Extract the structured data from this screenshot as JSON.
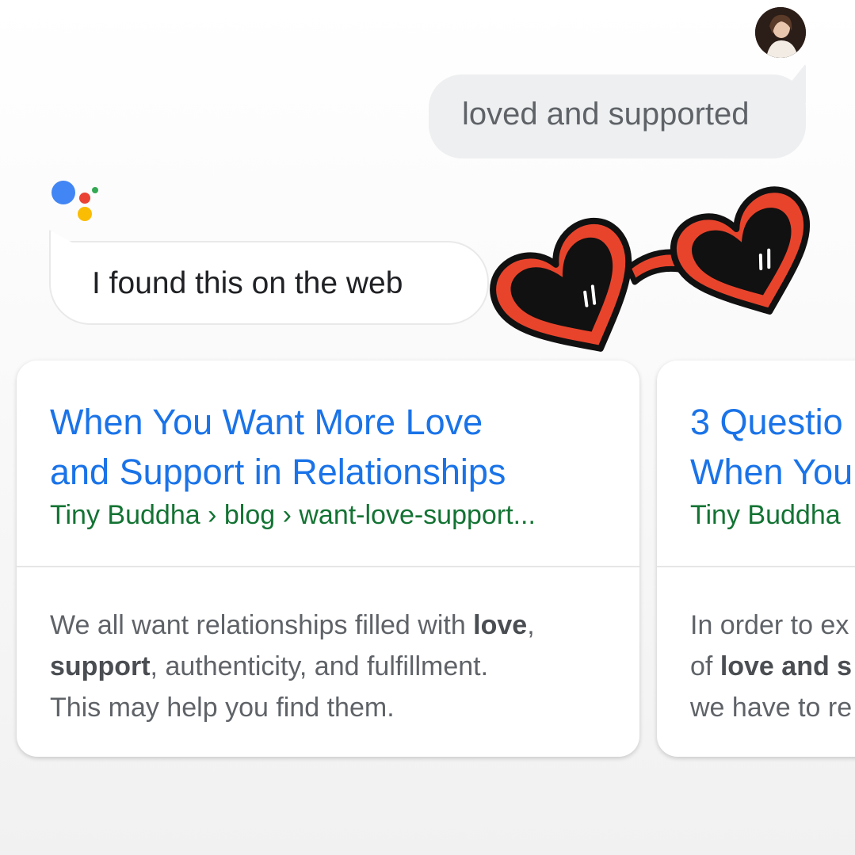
{
  "conversation": {
    "user_query": "loved and supported",
    "assistant_reply": "I found this on the web"
  },
  "icons": {
    "avatar": "user-avatar",
    "assistant": "google-assistant-dots-icon",
    "sticker": "heart-sunglasses-sticker"
  },
  "colors": {
    "link_blue": "#1a73e8",
    "source_green": "#137333",
    "assistant_blue": "#4285f4",
    "assistant_red": "#ea4335",
    "assistant_yellow": "#fbbc04",
    "assistant_green": "#34a853",
    "sticker_red": "#e8442c"
  },
  "results": [
    {
      "title_line1": "When You Want More Love",
      "title_line2": "and Support in Relationships",
      "source": "Tiny Buddha › blog › want-love-support...",
      "snippet": {
        "l1_a": "We all want relationships filled with ",
        "l1_bold": "love",
        "l1_b": ",",
        "l2_bold": "support",
        "l2_a": ", authenticity, and fulfillment.",
        "l3": "This may help you find them."
      }
    },
    {
      "title_line1": "3 Questio",
      "title_line2": "When You",
      "source": "Tiny Buddha",
      "snippet": {
        "l1": "In order to ex",
        "l2_a": "of ",
        "l2_bold": "love and s",
        "l3": "we have to re"
      }
    }
  ]
}
